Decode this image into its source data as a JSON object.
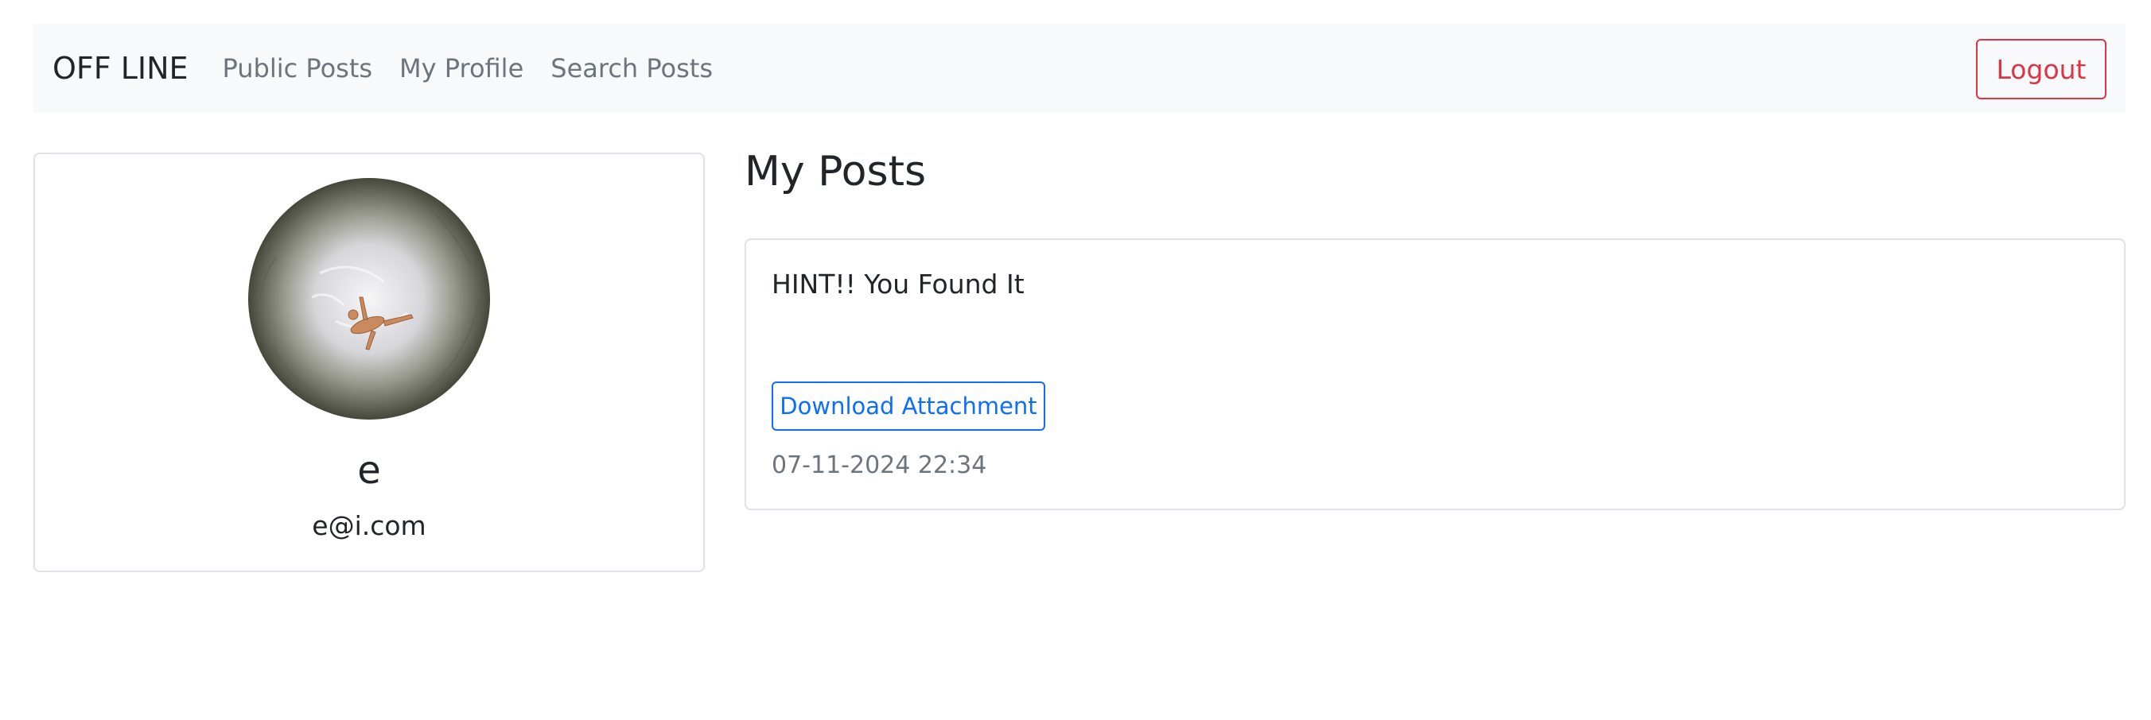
{
  "navbar": {
    "brand": "OFF LINE",
    "links": [
      {
        "label": "Public Posts"
      },
      {
        "label": "My Profile"
      },
      {
        "label": "Search Posts"
      }
    ],
    "logout_label": "Logout"
  },
  "profile": {
    "username": "e",
    "email": "e@i.com"
  },
  "posts_section": {
    "title": "My Posts",
    "posts": [
      {
        "text": "HINT!! You Found It",
        "download_label": "Download Attachment",
        "timestamp": "07-11-2024 22:34"
      }
    ]
  },
  "colors": {
    "navbar_bg": "#f8f9fa",
    "logout": "#dc3545",
    "primary": "#0d6efd",
    "muted": "#6c757d"
  }
}
